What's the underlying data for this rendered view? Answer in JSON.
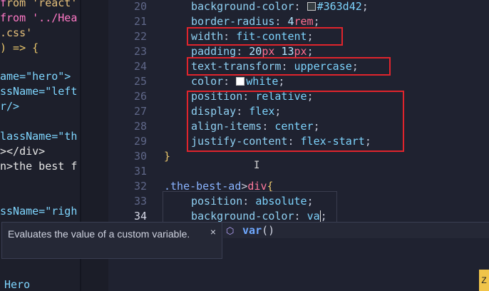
{
  "left_pane": {
    "lines": [
      {
        "text": "rom 'react'",
        "top": 0
      },
      {
        "text": "from '../Hea",
        "top": 0
      },
      {
        "text": ".css'",
        "top": 0
      },
      {
        "text": ") => {",
        "top": 0
      },
      {
        "text": "ame=\"hero\">",
        "top": 0
      },
      {
        "text": "ssName=\"left",
        "top": 0
      },
      {
        "text": "r/>",
        "top": 0
      },
      {
        "text": "lassName=\"th",
        "top": 0
      },
      {
        "text": "></div>",
        "top": 0
      },
      {
        "text": "n>the best f",
        "top": 0
      },
      {
        "text": "ssName=\"righ",
        "top": 0
      },
      {
        "text": "Hero",
        "top": 0
      }
    ]
  },
  "editor": {
    "line_numbers": [
      "20",
      "21",
      "22",
      "23",
      "24",
      "25",
      "26",
      "27",
      "28",
      "29",
      "30",
      "31",
      "32",
      "33",
      "34"
    ],
    "active_line": "34",
    "lines": {
      "l20_prop": "background-color",
      "l20_val": "#363d42",
      "l21_prop": "border-radius",
      "l21_num": "4",
      "l21_unit": "rem",
      "l22_prop": "width",
      "l22_val": "fit-content",
      "l23_prop": "padding",
      "l23_num1": "20",
      "l23_unit1": "px",
      "l23_num2": "13",
      "l23_unit2": "px",
      "l24_prop": "text-transform",
      "l24_val": "uppercase",
      "l25_prop": "color",
      "l25_val": "white",
      "l26_prop": "position",
      "l26_val": "relative",
      "l27_prop": "display",
      "l27_val": "flex",
      "l28_prop": "align-items",
      "l28_val": "center",
      "l29_prop": "justify-content",
      "l29_val": "flex-start",
      "l30": "}",
      "l32_sel": ".the-best-ad",
      "l32_gt": ">",
      "l32_tag": "div",
      "l32_brace": "{",
      "l33_prop": "position",
      "l33_val": "absolute",
      "l34_prop": "background-color",
      "l34_val": "va"
    }
  },
  "tooltip": {
    "text": "Evaluates the value of a custom variable.",
    "close": "×"
  },
  "suggestion": {
    "icon": "cube-icon",
    "match": "var",
    "rest": "()"
  },
  "colors": {
    "highlight_box": "#e0242c",
    "swatch_363d42": "#363d42",
    "swatch_white": "#ffffff"
  },
  "corner_badge": "Z"
}
